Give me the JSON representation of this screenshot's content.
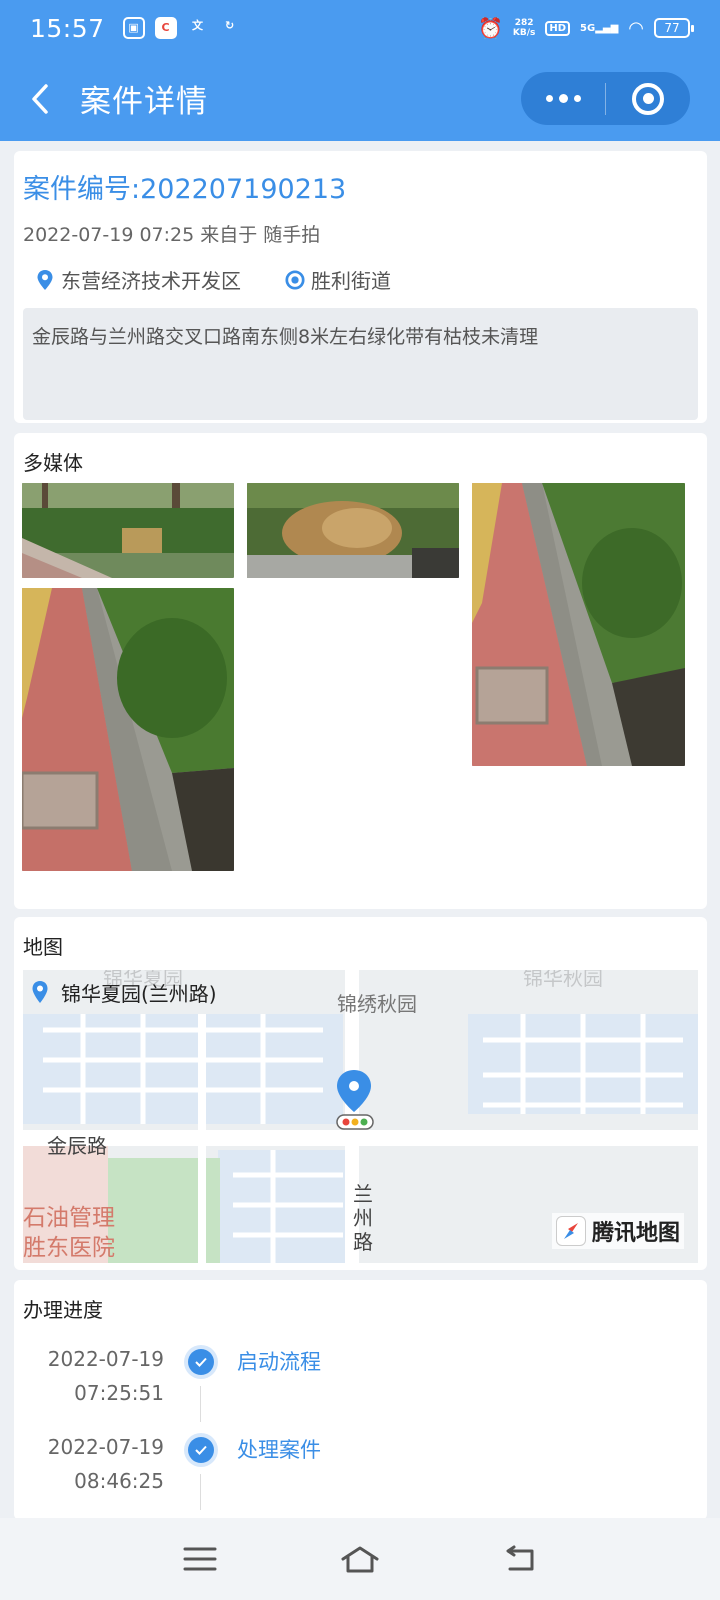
{
  "status_bar": {
    "time": "15:57",
    "net_speed_value": "282",
    "net_speed_unit": "KB/s",
    "hd": "HD",
    "network": "5G",
    "battery": "77",
    "app_icons": [
      "album-icon",
      "video-icon",
      "translate-icon",
      "sync-icon"
    ]
  },
  "header": {
    "title": "案件详情",
    "back_icon": "back-arrow-icon",
    "more_icon": "more-dots-icon",
    "close_icon": "mini-program-close-icon",
    "color": "#4a9bf0"
  },
  "case": {
    "number": "案件编号:202207190213",
    "meta": "2022-07-19 07:25 来自于 随手拍",
    "area": "东营经济技术开发区",
    "street": "胜利街道",
    "description": "金辰路与兰州路交叉口路南东侧8米左右绿化带有枯枝未清理",
    "accent": "#3a8ee6"
  },
  "media": {
    "title": "多媒体",
    "photos": [
      {
        "alt": "photo-1"
      },
      {
        "alt": "photo-2"
      },
      {
        "alt": "photo-3"
      },
      {
        "alt": "photo-4"
      }
    ]
  },
  "map": {
    "title": "地图",
    "location": "锦华夏园(兰州路)",
    "labels": {
      "top_left_faded": "锦华夏园",
      "top_right_faded": "锦华秋园",
      "community": "锦绣秋园",
      "road_east_west": "金辰路",
      "road_north_south": "兰州路",
      "bottom_left_1": "石油管理",
      "bottom_left_2": "胜东医院"
    },
    "provider": "腾讯地图"
  },
  "progress": {
    "title": "办理进度",
    "steps": [
      {
        "date": "2022-07-19",
        "time": "07:25:51",
        "label": "启动流程"
      },
      {
        "date": "2022-07-19",
        "time": "08:46:25",
        "label": "处理案件"
      }
    ]
  },
  "system_nav": {
    "menu_icon": "menu-icon",
    "home_icon": "home-icon",
    "back_icon": "back-icon"
  }
}
